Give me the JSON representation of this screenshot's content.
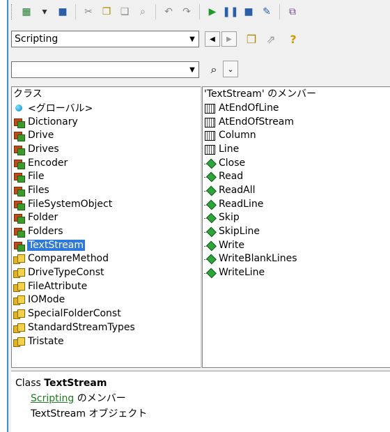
{
  "toolbar": {
    "buttons": [
      {
        "name": "excel-icon",
        "glyph": "▦",
        "color": "#1e7b2e"
      },
      {
        "name": "dropdown-form-icon",
        "glyph": "▾",
        "color": "#333"
      },
      {
        "name": "save-icon",
        "glyph": "■",
        "color": "#2a5fa8"
      },
      {
        "name": "cut-icon",
        "glyph": "✂",
        "color": "#888"
      },
      {
        "name": "copy-icon",
        "glyph": "❐",
        "color": "#b08a00"
      },
      {
        "name": "paste-icon",
        "glyph": "❏",
        "color": "#888"
      },
      {
        "name": "find-icon",
        "glyph": "⌕",
        "color": "#888"
      },
      {
        "name": "undo-icon",
        "glyph": "↶",
        "color": "#888"
      },
      {
        "name": "redo-icon",
        "glyph": "↷",
        "color": "#888"
      },
      {
        "name": "run-icon",
        "glyph": "▶",
        "color": "#1a9b2a"
      },
      {
        "name": "break-icon",
        "glyph": "❚❚",
        "color": "#2a5fa8"
      },
      {
        "name": "reset-icon",
        "glyph": "■",
        "color": "#2a5fa8"
      },
      {
        "name": "design-mode-icon",
        "glyph": "✎",
        "color": "#2a5fa8"
      },
      {
        "name": "project-explorer-icon",
        "glyph": "⧉",
        "color": "#7a3f9a"
      }
    ]
  },
  "library_combo": {
    "value": "Scripting"
  },
  "search_combo": {
    "value": ""
  },
  "nav": {
    "back": "◀",
    "forward": "▶"
  },
  "classes_header": "クラス",
  "members_header": "'TextStream' のメンバー",
  "classes": [
    {
      "label": "<グローバル>",
      "kind": "globe"
    },
    {
      "label": "Dictionary",
      "kind": "class"
    },
    {
      "label": "Drive",
      "kind": "class"
    },
    {
      "label": "Drives",
      "kind": "class"
    },
    {
      "label": "Encoder",
      "kind": "class"
    },
    {
      "label": "File",
      "kind": "class"
    },
    {
      "label": "Files",
      "kind": "class"
    },
    {
      "label": "FileSystemObject",
      "kind": "class"
    },
    {
      "label": "Folder",
      "kind": "class"
    },
    {
      "label": "Folders",
      "kind": "class"
    },
    {
      "label": "TextStream",
      "kind": "class",
      "selected": true
    },
    {
      "label": "CompareMethod",
      "kind": "enum"
    },
    {
      "label": "DriveTypeConst",
      "kind": "enum"
    },
    {
      "label": "FileAttribute",
      "kind": "enum"
    },
    {
      "label": "IOMode",
      "kind": "enum"
    },
    {
      "label": "SpecialFolderConst",
      "kind": "enum"
    },
    {
      "label": "StandardStreamTypes",
      "kind": "enum"
    },
    {
      "label": "Tristate",
      "kind": "enum"
    }
  ],
  "members": [
    {
      "label": "AtEndOfLine",
      "kind": "prop"
    },
    {
      "label": "AtEndOfStream",
      "kind": "prop"
    },
    {
      "label": "Column",
      "kind": "prop"
    },
    {
      "label": "Line",
      "kind": "prop"
    },
    {
      "label": "Close",
      "kind": "method"
    },
    {
      "label": "Read",
      "kind": "method"
    },
    {
      "label": "ReadAll",
      "kind": "method"
    },
    {
      "label": "ReadLine",
      "kind": "method"
    },
    {
      "label": "Skip",
      "kind": "method"
    },
    {
      "label": "SkipLine",
      "kind": "method"
    },
    {
      "label": "Write",
      "kind": "method"
    },
    {
      "label": "WriteBlankLines",
      "kind": "method"
    },
    {
      "label": "WriteLine",
      "kind": "method"
    }
  ],
  "details": {
    "prefix": "Class ",
    "class_name": "TextStream",
    "library_link": "Scripting",
    "member_of": " のメンバー",
    "description": "TextStream オブジェクト"
  },
  "colors": {
    "selection": "#2f7ad9",
    "link": "#1f7a1f"
  }
}
